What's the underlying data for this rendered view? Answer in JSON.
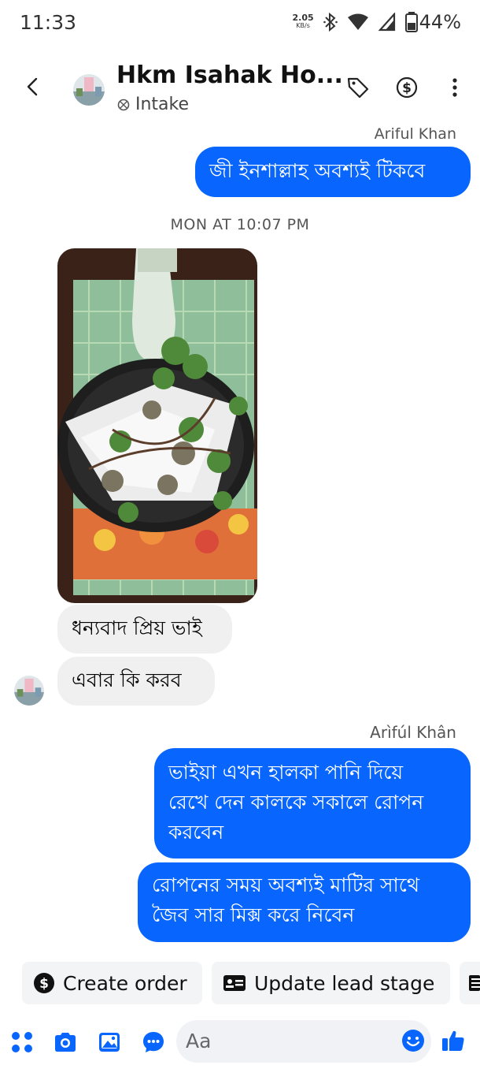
{
  "status_bar": {
    "time": "11:33",
    "network_speed": "2.05",
    "network_unit": "KB/s",
    "battery": "44%"
  },
  "header": {
    "contact_name": "Hkm Isahak Ho...",
    "label": "Intake",
    "icons": [
      "back-icon",
      "tag-icon",
      "dollar-icon",
      "more-icon"
    ]
  },
  "chat": {
    "top_sender_partial": "Ariful Khan",
    "msg1": "জী ইনশাল্লাহ অবশ্যই টিকবে",
    "timestamp": "MON AT 10:07 PM",
    "in_msg1": "ধন্যবাদ প্রিয় ভাই",
    "in_msg2": "এবার কি করব",
    "sender_name": "Arìfúl Khân",
    "out_msg2_line1": "ভাইয়া এখন হালকা পানি দিয়ে",
    "out_msg2_line2": "রেখে দেন কালকে সকালে রোপন",
    "out_msg2_line3": "করবেন",
    "out_msg3_line1": "রোপনের সময় অবশ্যই মাটির সাথে",
    "out_msg3_line2": "জৈব সার মিক্স করে নিবেন"
  },
  "quick_actions": {
    "create_order": "Create order",
    "update_lead": "Update lead stage"
  },
  "composer": {
    "placeholder": "Aa"
  },
  "colors": {
    "accent": "#0866ff",
    "incoming_bubble": "#f0f0f0"
  }
}
